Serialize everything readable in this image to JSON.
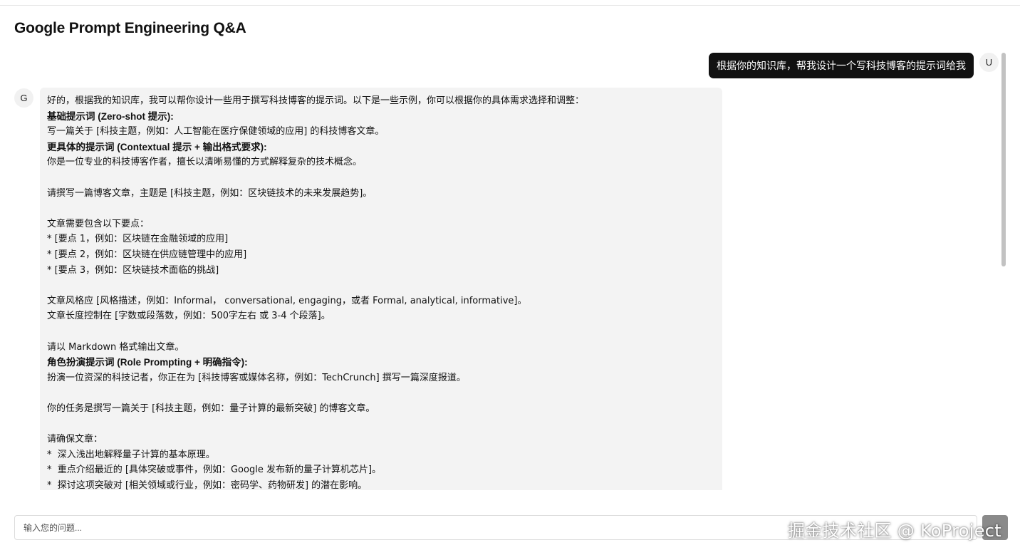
{
  "page": {
    "title": "Google Prompt Engineering Q&A"
  },
  "user": {
    "avatar_letter": "U",
    "message": "根据你的知识库，帮我设计一个写科技博客的提示词给我"
  },
  "bot": {
    "avatar_letter": "G",
    "lines": [
      {
        "text": "好的，根据我的知识库，我可以帮你设计一些用于撰写科技博客的提示词。以下是一些示例，你可以根据你的具体需求选择和调整：",
        "bold": false
      },
      {
        "text": "基础提示词 (Zero-shot 提示):",
        "bold": true
      },
      {
        "text": "写一篇关于 [科技主题，例如：人工智能在医疗保健领域的应用] 的科技博客文章。",
        "bold": false
      },
      {
        "text": "更具体的提示词 (Contextual 提示 + 输出格式要求):",
        "bold": true
      },
      {
        "text": "你是一位专业的科技博客作者，擅长以清晰易懂的方式解释复杂的技术概念。",
        "bold": false
      },
      {
        "text": "",
        "bold": false
      },
      {
        "text": "请撰写一篇博客文章，主题是 [科技主题，例如：区块链技术的未来发展趋势]。",
        "bold": false
      },
      {
        "text": "",
        "bold": false
      },
      {
        "text": "文章需要包含以下要点：",
        "bold": false
      },
      {
        "text": "* [要点 1，例如：区块链在金融领域的应用]",
        "bold": false
      },
      {
        "text": "* [要点 2，例如：区块链在供应链管理中的应用]",
        "bold": false
      },
      {
        "text": "* [要点 3，例如：区块链技术面临的挑战]",
        "bold": false
      },
      {
        "text": "",
        "bold": false
      },
      {
        "text": "文章风格应 [风格描述，例如：Informal， conversational, engaging，或者 Formal, analytical, informative]。",
        "bold": false
      },
      {
        "text": "文章长度控制在 [字数或段落数，例如：500字左右 或 3-4 个段落]。",
        "bold": false
      },
      {
        "text": "",
        "bold": false
      },
      {
        "text": "请以 Markdown 格式输出文章。",
        "bold": false
      },
      {
        "text": "角色扮演提示词 (Role Prompting + 明确指令):",
        "bold": true
      },
      {
        "text": "扮演一位资深的科技记者，你正在为 [科技博客或媒体名称，例如：TechCrunch] 撰写一篇深度报道。",
        "bold": false
      },
      {
        "text": "",
        "bold": false
      },
      {
        "text": "你的任务是撰写一篇关于 [科技主题，例如：量子计算的最新突破] 的博客文章。",
        "bold": false
      },
      {
        "text": "",
        "bold": false
      },
      {
        "text": "请确保文章：",
        "bold": false
      },
      {
        "text": "*  深入浅出地解释量子计算的基本原理。",
        "bold": false
      },
      {
        "text": "*  重点介绍最近的 [具体突破或事件，例如：Google 发布新的量子计算机芯片]。",
        "bold": false
      },
      {
        "text": "*  探讨这项突破对 [相关领域或行业，例如：密码学、药物研发] 的潜在影响。",
        "bold": false
      }
    ]
  },
  "input": {
    "placeholder": "输入您的问题..."
  },
  "watermark": {
    "text": "掘金技术社区 @ KoProject"
  },
  "colors": {
    "user_bubble": "#111111",
    "bot_bubble": "#f3f3f3",
    "send_button": "#8a8a8a"
  }
}
